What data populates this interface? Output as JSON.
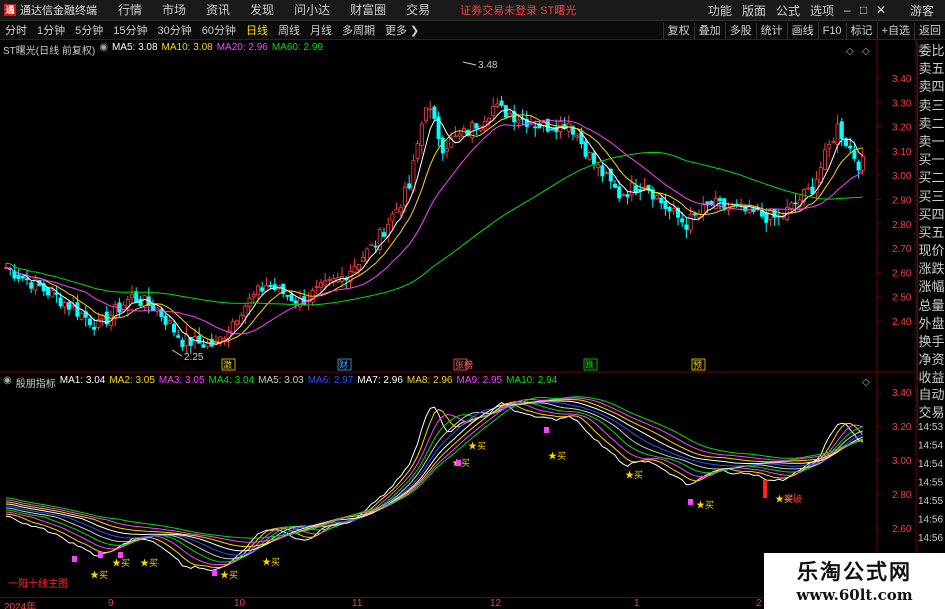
{
  "app": {
    "logo_text": "通达信金融终端",
    "menu": [
      "行情",
      "市场",
      "资讯",
      "发现",
      "问小达",
      "财富圈",
      "交易"
    ],
    "notice": "证券交易未登录  ST曙光",
    "right_menu": [
      "功能",
      "版面",
      "公式",
      "选项"
    ],
    "guest": "游客"
  },
  "toolbar": {
    "periods": [
      "分时",
      "1分钟",
      "5分钟",
      "15分钟",
      "30分钟",
      "60分钟",
      "日线",
      "周线",
      "月线",
      "多周期",
      "更多"
    ],
    "active_period": "日线",
    "tools": [
      "复权",
      "叠加",
      "多股",
      "统计",
      "画线",
      "F10",
      "标记",
      "+自选",
      "返回"
    ]
  },
  "main_chart": {
    "title": "ST曙光(日线 前复权)",
    "ma_labels": [
      {
        "text": "MA5: 3.08",
        "color": "#ffffff"
      },
      {
        "text": "MA10: 3.08",
        "color": "#ffd700"
      },
      {
        "text": "MA20: 2.96",
        "color": "#ff40ff"
      },
      {
        "text": "MA60: 2.99",
        "color": "#00e000"
      }
    ],
    "y_ticks": [
      "3.40",
      "3.30",
      "3.20",
      "3.10",
      "3.00",
      "2.90",
      "2.80",
      "2.70",
      "2.60",
      "2.50",
      "2.40"
    ],
    "high_label": "3.48",
    "low_label": "2.25",
    "event_markers": [
      {
        "text": "激",
        "color": "#ffd700"
      },
      {
        "text": "财",
        "color": "#4da6ff"
      },
      {
        "text": "张榜",
        "color": "#ff6060"
      },
      {
        "text": "跌",
        "color": "#00e000"
      },
      {
        "text": "预",
        "color": "#ffd700"
      }
    ]
  },
  "sub_chart": {
    "title": "殷朋指标",
    "ma_labels": [
      {
        "text": "MA1: 3.04",
        "color": "#ffffff"
      },
      {
        "text": "MA2: 3.05",
        "color": "#ffd700"
      },
      {
        "text": "MA3: 3.05",
        "color": "#ff40ff"
      },
      {
        "text": "MA4: 3.04",
        "color": "#00e000"
      },
      {
        "text": "MA5: 3.03",
        "color": "#cccccc"
      },
      {
        "text": "MA6: 2.97",
        "color": "#3050ff"
      },
      {
        "text": "MA7: 2.96",
        "color": "#ffffff"
      },
      {
        "text": "MA8: 2.96",
        "color": "#ffd700"
      },
      {
        "text": "MA9: 2.95",
        "color": "#ff40ff"
      },
      {
        "text": "MA10: 2.94",
        "color": "#00e000"
      }
    ],
    "y_ticks": [
      "3.40",
      "3.20",
      "3.00",
      "2.80",
      "2.60"
    ],
    "buy_label": "★买",
    "breakout_label": "突破",
    "bottom_note": "一阳十线主图"
  },
  "side_panel": [
    "委比",
    "卖五",
    "卖四",
    "卖三",
    "卖二",
    "卖一",
    "买一",
    "买二",
    "买三",
    "买四",
    "买五",
    "现价",
    "涨跌",
    "涨幅",
    "总量",
    "外盘",
    "换手",
    "净资",
    "收益"
  ],
  "side_panel2": [
    "自动",
    "交易"
  ],
  "time_labels": [
    "14:53",
    "14:54",
    "14:54",
    "14:55",
    "14:55",
    "14:56",
    "14:56"
  ],
  "x_axis": [
    "2024年",
    "9",
    "10",
    "11",
    "12",
    "1",
    "2"
  ],
  "watermark": {
    "main": "乐淘公式网",
    "url": "www.60lt.com"
  },
  "colors": {
    "up": "#ff3b3b",
    "down": "#00ffff",
    "ma5": "#ffffff",
    "ma10": "#ffd700",
    "ma20": "#ff40ff",
    "ma60": "#00e000",
    "border": "#7a0000"
  }
}
